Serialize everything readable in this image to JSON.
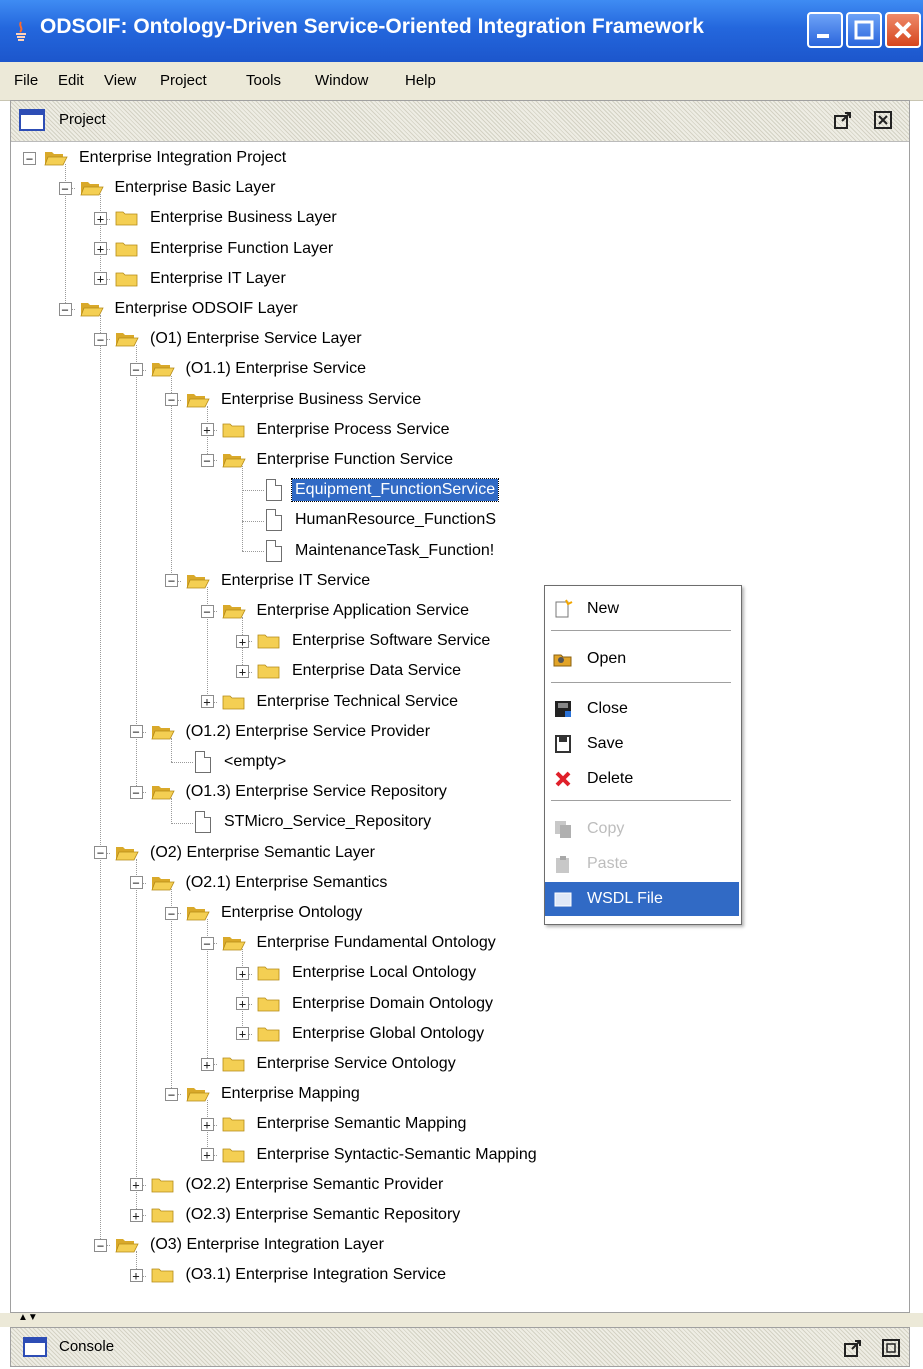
{
  "window": {
    "title": "ODSOIF: Ontology-Driven Service-Oriented Integration Framework"
  },
  "menu": [
    "File",
    "Edit",
    "View",
    "Project",
    "Tools",
    "Window",
    "Help"
  ],
  "project_panel": {
    "title": "Project"
  },
  "tree": [
    {
      "label": "Enterprise Integration Project",
      "icon": "folder-open",
      "expander": "minus"
    },
    {
      "label": "Enterprise Basic Layer",
      "icon": "folder-open",
      "expander": "minus"
    },
    {
      "label": "Enterprise Business Layer",
      "icon": "folder-closed",
      "expander": "plus"
    },
    {
      "label": "Enterprise Function Layer",
      "icon": "folder-closed",
      "expander": "plus"
    },
    {
      "label": "Enterprise IT Layer",
      "icon": "folder-closed",
      "expander": "plus"
    },
    {
      "label": "Enterprise ODSOIF Layer",
      "icon": "folder-open",
      "expander": "minus"
    },
    {
      "label": "(O1) Enterprise Service Layer",
      "icon": "folder-open",
      "expander": "minus"
    },
    {
      "label": "(O1.1) Enterprise Service",
      "icon": "folder-open",
      "expander": "minus"
    },
    {
      "label": "Enterprise Business Service",
      "icon": "folder-open",
      "expander": "minus"
    },
    {
      "label": "Enterprise Process Service",
      "icon": "folder-closed",
      "expander": "plus"
    },
    {
      "label": "Enterprise Function Service",
      "icon": "folder-open",
      "expander": "minus"
    },
    {
      "label": "Equipment_FunctionService",
      "icon": "file",
      "selected": true
    },
    {
      "label": "HumanResource_FunctionS",
      "icon": "file"
    },
    {
      "label": "MaintenanceTask_Function!",
      "icon": "file"
    },
    {
      "label": "Enterprise IT Service",
      "icon": "folder-open",
      "expander": "minus"
    },
    {
      "label": "Enterprise Application Service",
      "icon": "folder-open",
      "expander": "minus"
    },
    {
      "label": "Enterprise Software Service",
      "icon": "folder-closed",
      "expander": "plus"
    },
    {
      "label": "Enterprise Data Service",
      "icon": "folder-closed",
      "expander": "plus"
    },
    {
      "label": "Enterprise Technical Service",
      "icon": "folder-closed",
      "expander": "plus"
    },
    {
      "label": "(O1.2) Enterprise Service Provider",
      "icon": "folder-open",
      "expander": "minus"
    },
    {
      "label": "<empty>",
      "icon": "file"
    },
    {
      "label": "(O1.3) Enterprise Service Repository",
      "icon": "folder-open",
      "expander": "minus"
    },
    {
      "label": "STMicro_Service_Repository",
      "icon": "file"
    },
    {
      "label": "(O2) Enterprise Semantic Layer",
      "icon": "folder-open",
      "expander": "minus"
    },
    {
      "label": "(O2.1) Enterprise Semantics",
      "icon": "folder-open",
      "expander": "minus"
    },
    {
      "label": "Enterprise Ontology",
      "icon": "folder-open",
      "expander": "minus"
    },
    {
      "label": "Enterprise Fundamental Ontology",
      "icon": "folder-open",
      "expander": "minus"
    },
    {
      "label": "Enterprise Local Ontology",
      "icon": "folder-closed",
      "expander": "plus"
    },
    {
      "label": "Enterprise Domain Ontology",
      "icon": "folder-closed",
      "expander": "plus"
    },
    {
      "label": "Enterprise Global Ontology",
      "icon": "folder-closed",
      "expander": "plus"
    },
    {
      "label": "Enterprise Service Ontology",
      "icon": "folder-closed",
      "expander": "plus"
    },
    {
      "label": "Enterprise Mapping",
      "icon": "folder-open",
      "expander": "minus"
    },
    {
      "label": "Enterprise Semantic Mapping",
      "icon": "folder-closed",
      "expander": "plus"
    },
    {
      "label": "Enterprise Syntactic-Semantic Mapping",
      "icon": "folder-closed",
      "expander": "plus"
    },
    {
      "label": "(O2.2) Enterprise Semantic Provider",
      "icon": "folder-closed",
      "expander": "plus"
    },
    {
      "label": "(O2.3) Enterprise Semantic Repository",
      "icon": "folder-closed",
      "expander": "plus"
    },
    {
      "label": "(O3) Enterprise Integration Layer",
      "icon": "folder-open",
      "expander": "minus"
    },
    {
      "label": "(O3.1) Enterprise Integration Service",
      "icon": "folder-closed",
      "expander": "plus"
    }
  ],
  "context_menu": {
    "items": [
      {
        "label": "New",
        "icon": "new-icon",
        "enabled": true
      },
      {
        "label": "Open",
        "icon": "open-icon",
        "enabled": true
      },
      {
        "label": "Close",
        "icon": "close-doc-icon",
        "enabled": true
      },
      {
        "label": "Save",
        "icon": "save-icon",
        "enabled": true
      },
      {
        "label": "Delete",
        "icon": "delete-icon",
        "enabled": true
      },
      {
        "label": "Copy",
        "icon": "copy-icon",
        "enabled": false
      },
      {
        "label": "Paste",
        "icon": "paste-icon",
        "enabled": false
      },
      {
        "label": "WSDL File",
        "icon": "wsdl-icon",
        "enabled": true,
        "highlighted": true
      }
    ]
  },
  "console_panel": {
    "title": "Console"
  },
  "colors": {
    "titlebar": "#2467dd",
    "selection": "#316ac5",
    "folder": "#f4cf53",
    "menubar": "#ece9d8"
  }
}
